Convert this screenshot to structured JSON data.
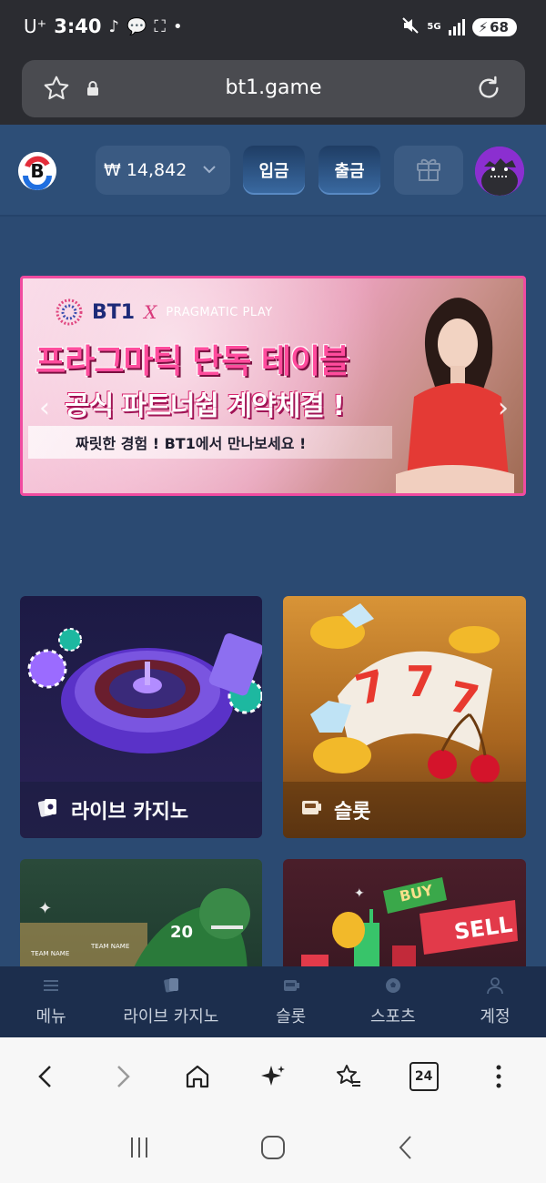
{
  "status_bar": {
    "carrier": "U⁺",
    "time": "3:40",
    "network": "5G",
    "battery": "68"
  },
  "browser": {
    "url": "bt1.game",
    "tab_count": "24"
  },
  "header": {
    "balance": "₩ 14,842",
    "deposit_label": "입금",
    "withdraw_label": "출금"
  },
  "banner": {
    "brand": "BT1",
    "x_mark": "X",
    "partner": "PRAGMATIC PLAY",
    "title_line1": "프라그마틱 단독 테이블",
    "title_line2": "공식 파트너쉽 계약체결 !",
    "subtitle": "짜릿한 경험 ! BT1에서 만나보세요 !"
  },
  "categories": [
    {
      "label": "라이브 카지노",
      "icon": "cards-icon"
    },
    {
      "label": "슬롯",
      "icon": "slot-machine-icon"
    }
  ],
  "card_art_text": {
    "jersey_number": "20",
    "team_name_1": "TEAM NAME",
    "team_name_2": "TEAM NAME",
    "buy": "BUY",
    "sell": "SELL"
  },
  "bottom_nav": [
    {
      "label": "메뉴",
      "icon": "menu-icon"
    },
    {
      "label": "라이브 카지노",
      "icon": "cards-icon"
    },
    {
      "label": "슬롯",
      "icon": "slot-machine-icon"
    },
    {
      "label": "스포츠",
      "icon": "soccer-ball-icon"
    },
    {
      "label": "계정",
      "icon": "user-icon"
    }
  ],
  "colors": {
    "page_bg": "#2b4a72",
    "header_bg": "#2d4e77",
    "banner_border": "#f04ba0",
    "bottom_nav_bg": "#1c2e4d"
  }
}
